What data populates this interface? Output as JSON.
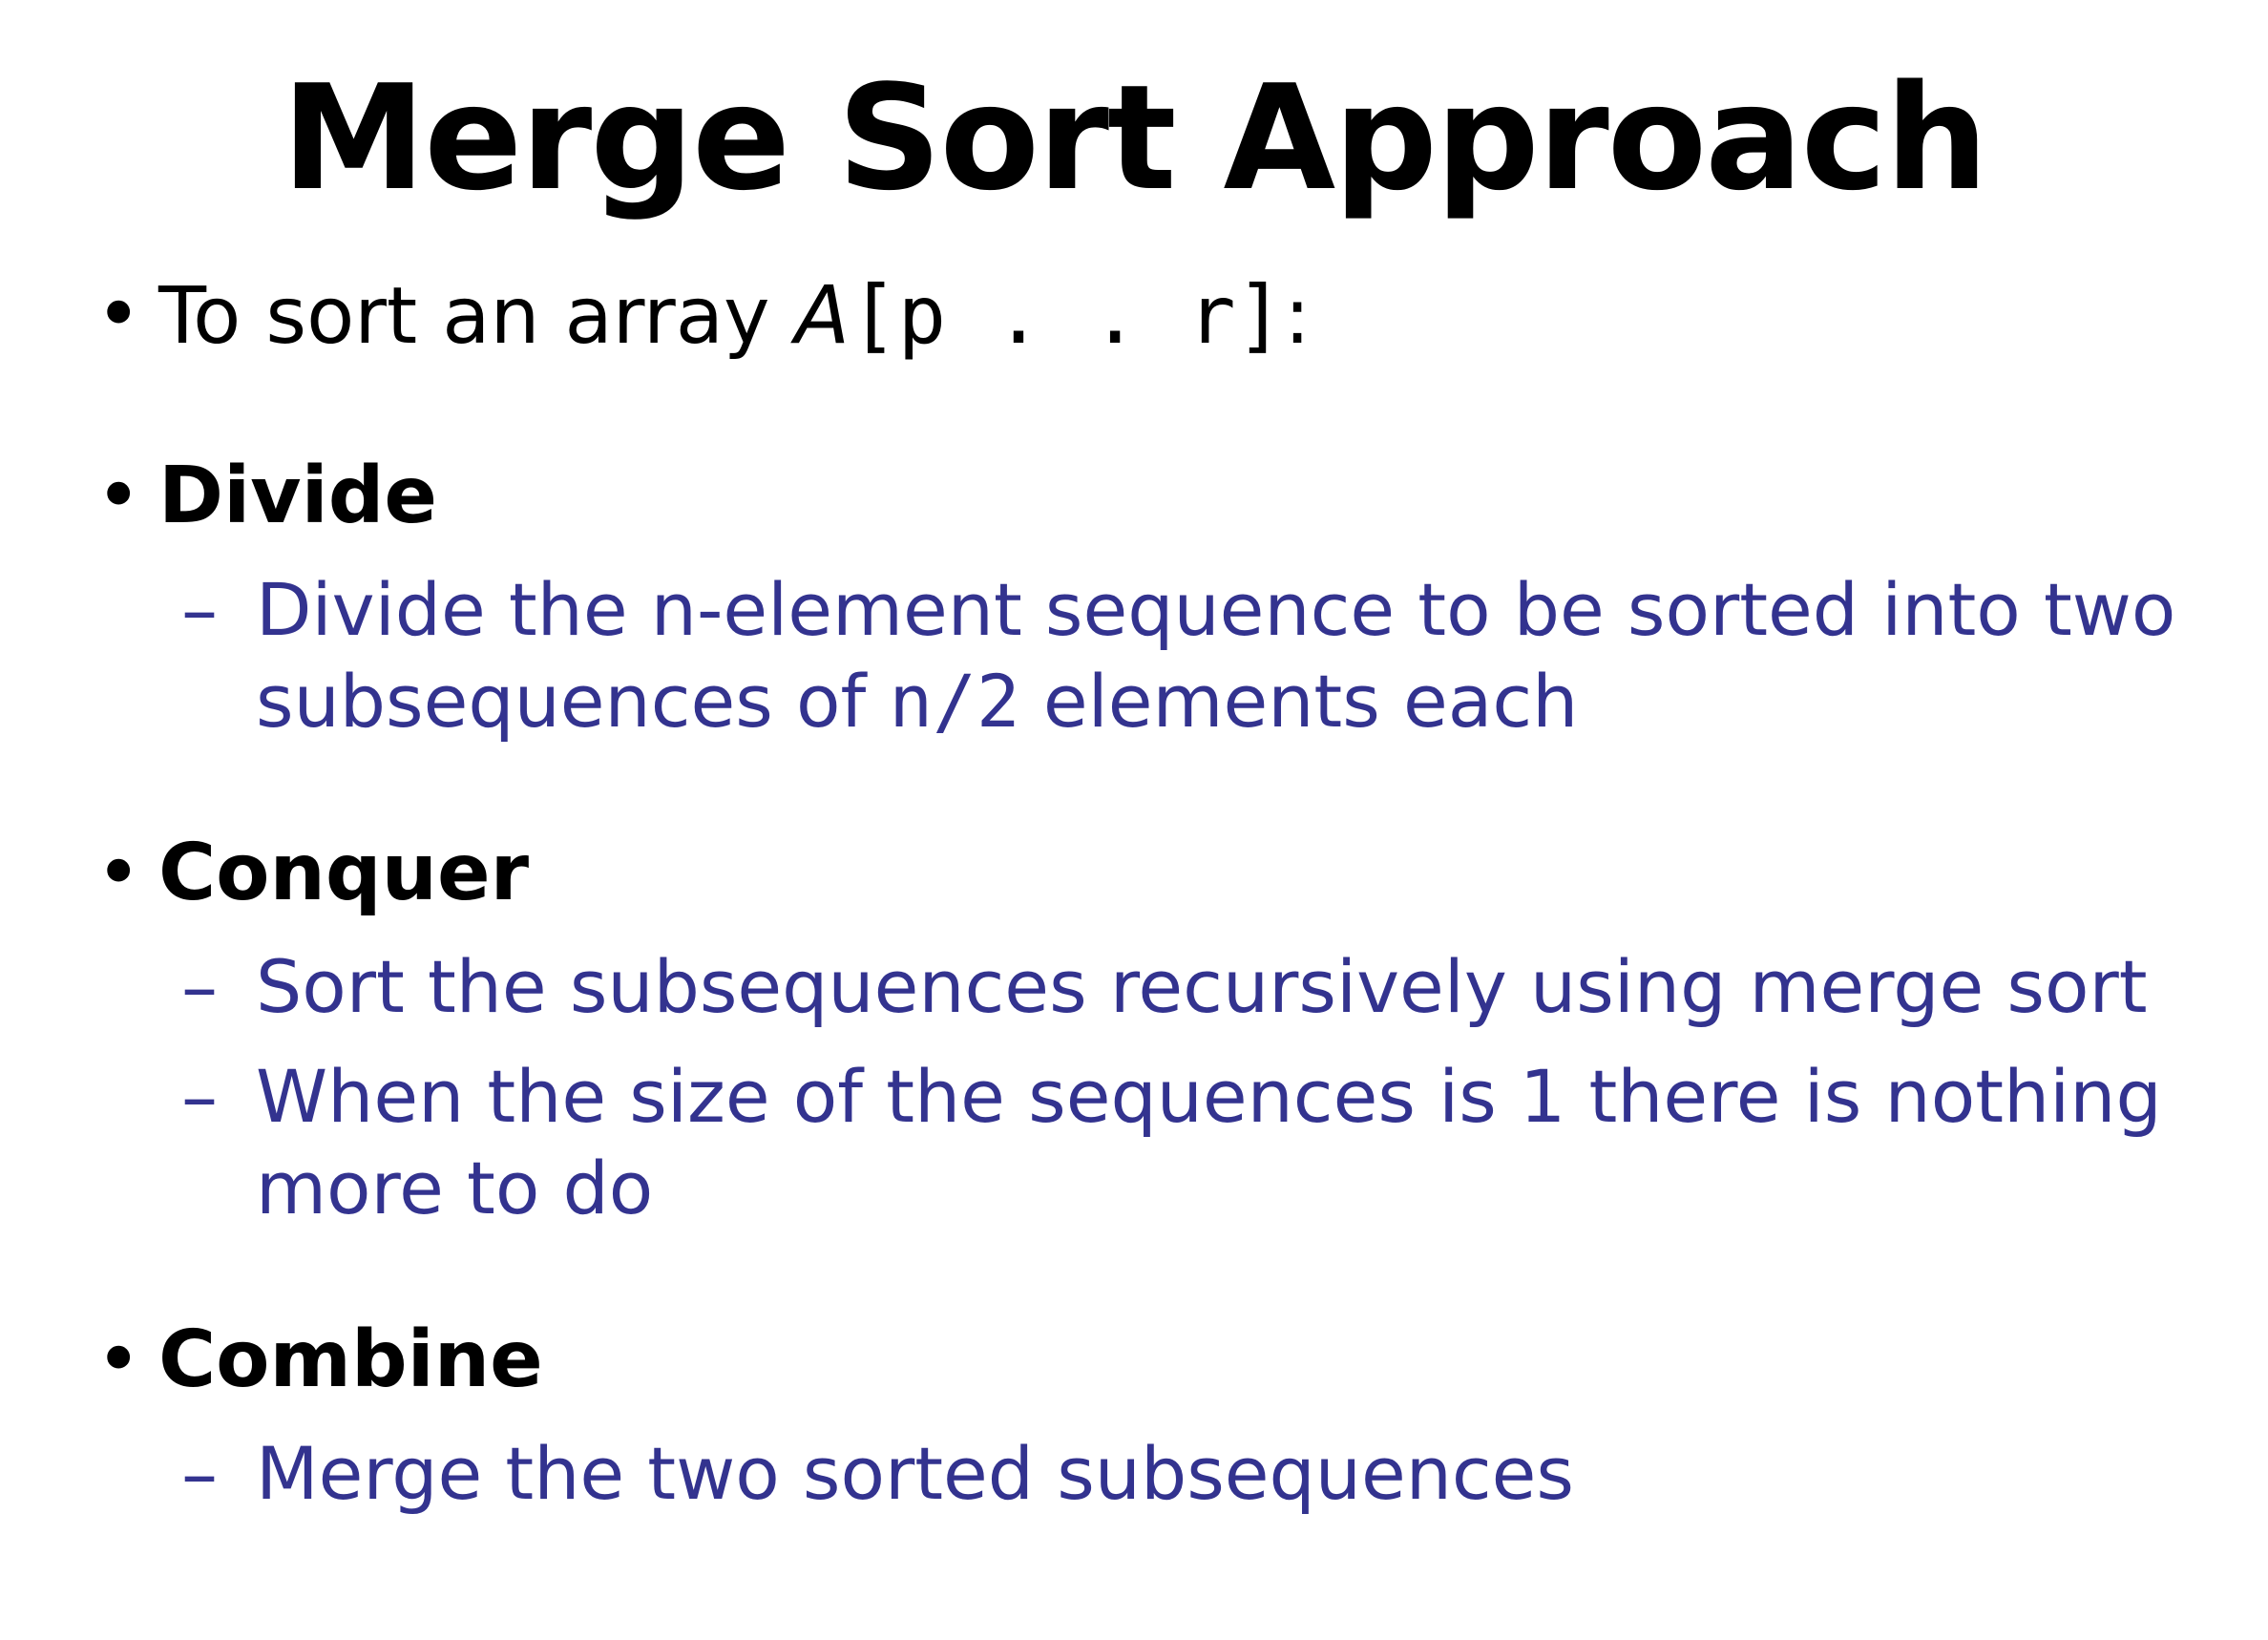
{
  "title": "Merge Sort Approach",
  "intro": {
    "bullet": "•",
    "text": "To sort an array ",
    "math_var": "A",
    "math_index": "[p . . r]",
    "suffix": ":"
  },
  "sections": [
    {
      "bullet": "•",
      "heading": "Divide",
      "items": [
        {
          "dash": "–",
          "line1": "Divide the n-element sequence to be sorted into two",
          "line2_prefix": "subsequences of ",
          "line2_math": "n/2",
          "line2_suffix": " elements each"
        }
      ]
    },
    {
      "bullet": "•",
      "heading": "Conquer",
      "items": [
        {
          "dash": "–",
          "line1": "Sort the subsequences recursively using merge sort"
        },
        {
          "dash": "–",
          "line1": "When the size of the sequences is 1 there is nothing",
          "line2": "more to do"
        }
      ]
    },
    {
      "bullet": "•",
      "heading": "Combine",
      "items": [
        {
          "dash": "–",
          "line1": "Merge the two sorted subsequences"
        }
      ]
    }
  ],
  "colors": {
    "heading": "#000000",
    "subtext": "#33338f",
    "background": "#ffffff"
  }
}
